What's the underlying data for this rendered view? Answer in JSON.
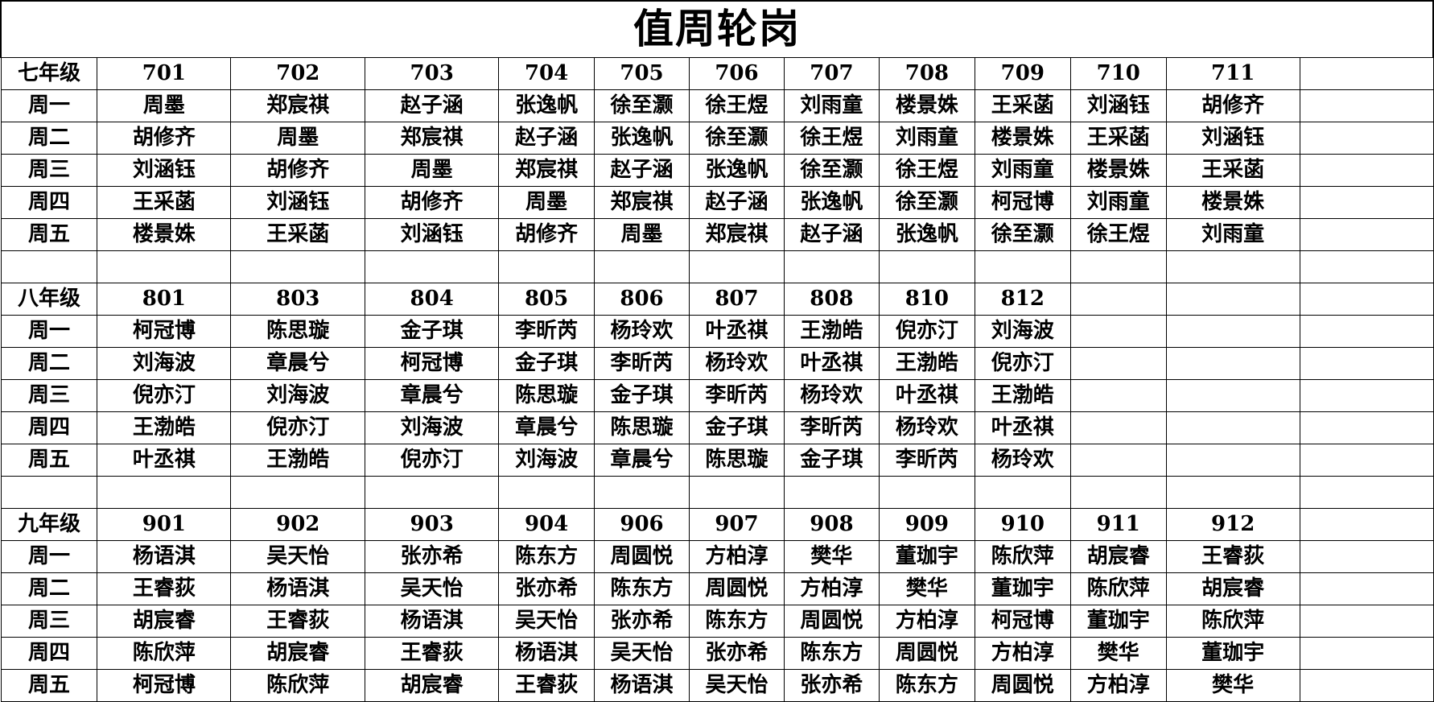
{
  "title": "值周轮岗",
  "sections": [
    {
      "grade": "七年级",
      "classes": [
        "701",
        "702",
        "703",
        "704",
        "705",
        "706",
        "707",
        "708",
        "709",
        "710",
        "711",
        ""
      ],
      "rows": [
        {
          "day": "周一",
          "cells": [
            "周墨",
            "郑宸祺",
            "赵子涵",
            "张逸帆",
            "徐至灏",
            "徐王煜",
            "刘雨童",
            "楼景姝",
            "王采菡",
            "刘涵钰",
            "胡修齐",
            ""
          ]
        },
        {
          "day": "周二",
          "cells": [
            "胡修齐",
            "周墨",
            "郑宸祺",
            "赵子涵",
            "张逸帆",
            "徐至灏",
            "徐王煜",
            "刘雨童",
            "楼景姝",
            "王采菡",
            "刘涵钰",
            ""
          ]
        },
        {
          "day": "周三",
          "cells": [
            "刘涵钰",
            "胡修齐",
            "周墨",
            "郑宸祺",
            "赵子涵",
            "张逸帆",
            "徐至灏",
            "徐王煜",
            "刘雨童",
            "楼景姝",
            "王采菡",
            ""
          ]
        },
        {
          "day": "周四",
          "cells": [
            "王采菡",
            "刘涵钰",
            "胡修齐",
            "周墨",
            "郑宸祺",
            "赵子涵",
            "张逸帆",
            "徐至灏",
            "柯冠博",
            "刘雨童",
            "楼景姝",
            ""
          ]
        },
        {
          "day": "周五",
          "cells": [
            "楼景姝",
            "王采菡",
            "刘涵钰",
            "胡修齐",
            "周墨",
            "郑宸祺",
            "赵子涵",
            "张逸帆",
            "徐至灏",
            "徐王煜",
            "刘雨童",
            ""
          ]
        }
      ]
    },
    {
      "grade": "八年级",
      "classes": [
        "801",
        "803",
        "804",
        "805",
        "806",
        "807",
        "808",
        "810",
        "812",
        "",
        "",
        ""
      ],
      "rows": [
        {
          "day": "周一",
          "cells": [
            "柯冠博",
            "陈思璇",
            "金子琪",
            "李昕芮",
            "杨玲欢",
            "叶丞祺",
            "王渤皓",
            "倪亦汀",
            "刘海波",
            "",
            "",
            ""
          ]
        },
        {
          "day": "周二",
          "cells": [
            "刘海波",
            "章晨兮",
            "柯冠博",
            "金子琪",
            "李昕芮",
            "杨玲欢",
            "叶丞祺",
            "王渤皓",
            "倪亦汀",
            "",
            "",
            ""
          ]
        },
        {
          "day": "周三",
          "cells": [
            "倪亦汀",
            "刘海波",
            "章晨兮",
            "陈思璇",
            "金子琪",
            "李昕芮",
            "杨玲欢",
            "叶丞祺",
            "王渤皓",
            "",
            "",
            ""
          ]
        },
        {
          "day": "周四",
          "cells": [
            "王渤皓",
            "倪亦汀",
            "刘海波",
            "章晨兮",
            "陈思璇",
            "金子琪",
            "李昕芮",
            "杨玲欢",
            "叶丞祺",
            "",
            "",
            ""
          ]
        },
        {
          "day": "周五",
          "cells": [
            "叶丞祺",
            "王渤皓",
            "倪亦汀",
            "刘海波",
            "章晨兮",
            "陈思璇",
            "金子琪",
            "李昕芮",
            "杨玲欢",
            "",
            "",
            ""
          ]
        }
      ]
    },
    {
      "grade": "九年级",
      "classes": [
        "901",
        "902",
        "903",
        "904",
        "906",
        "907",
        "908",
        "909",
        "910",
        "911",
        "912",
        ""
      ],
      "rows": [
        {
          "day": "周一",
          "cells": [
            "杨语淇",
            "吴天怡",
            "张亦希",
            "陈东方",
            "周圆悦",
            "方柏淳",
            "樊华",
            "董珈宇",
            "陈欣萍",
            "胡宸睿",
            "王睿荻",
            ""
          ]
        },
        {
          "day": "周二",
          "cells": [
            "王睿荻",
            "杨语淇",
            "吴天怡",
            "张亦希",
            "陈东方",
            "周圆悦",
            "方柏淳",
            "樊华",
            "董珈宇",
            "陈欣萍",
            "胡宸睿",
            ""
          ]
        },
        {
          "day": "周三",
          "cells": [
            "胡宸睿",
            "王睿荻",
            "杨语淇",
            "吴天怡",
            "张亦希",
            "陈东方",
            "周圆悦",
            "方柏淳",
            "柯冠博",
            "董珈宇",
            "陈欣萍",
            ""
          ]
        },
        {
          "day": "周四",
          "cells": [
            "陈欣萍",
            "胡宸睿",
            "王睿荻",
            "杨语淇",
            "吴天怡",
            "张亦希",
            "陈东方",
            "周圆悦",
            "方柏淳",
            "樊华",
            "董珈宇",
            ""
          ]
        },
        {
          "day": "周五",
          "cells": [
            "柯冠博",
            "陈欣萍",
            "胡宸睿",
            "王睿荻",
            "杨语淇",
            "吴天怡",
            "张亦希",
            "陈东方",
            "周圆悦",
            "方柏淳",
            "樊华",
            ""
          ]
        }
      ]
    }
  ]
}
